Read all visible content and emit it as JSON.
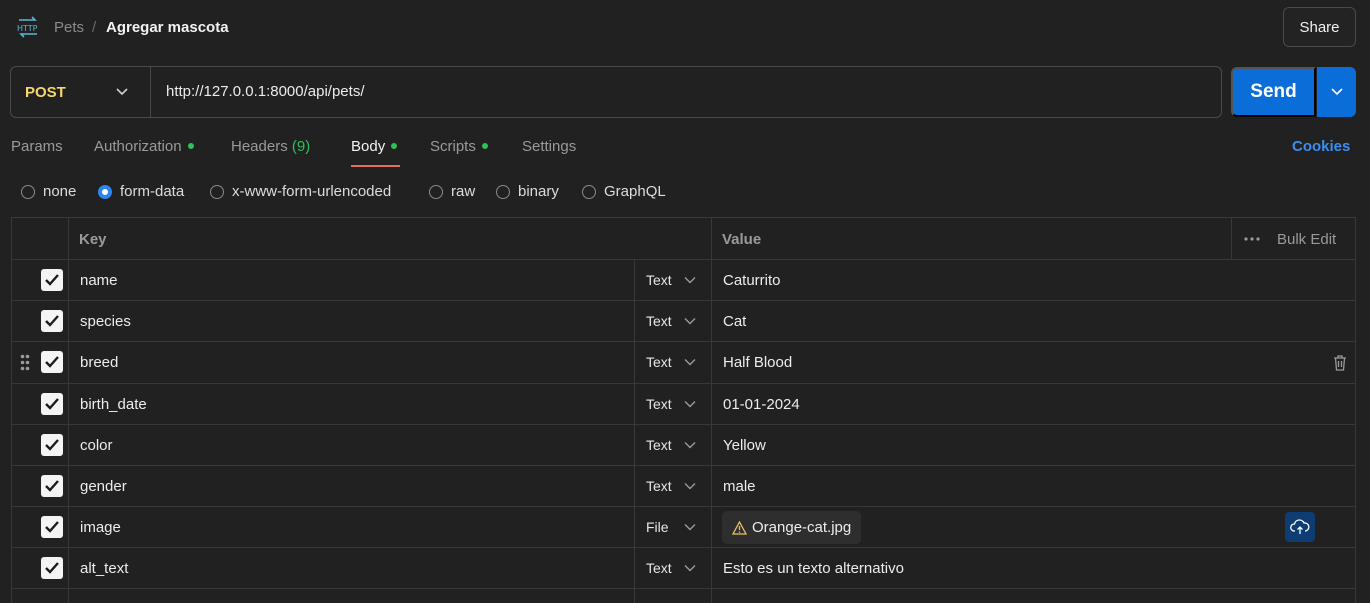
{
  "header": {
    "icon": "http-icon",
    "breadcrumb_parent": "Pets",
    "breadcrumb_sep": "/",
    "title": "Agregar mascota",
    "share_label": "Share"
  },
  "request": {
    "method": "POST",
    "method_color": "#f5d76e",
    "url": "http://127.0.0.1:8000/api/pets/",
    "send_label": "Send",
    "send_color": "#0b6ed8"
  },
  "tabs": [
    {
      "label": "Params"
    },
    {
      "label": "Authorization"
    },
    {
      "label": "Headers",
      "count": "(9)"
    },
    {
      "label": "Body",
      "active": true
    },
    {
      "label": "Scripts"
    },
    {
      "label": "Settings"
    }
  ],
  "cookies_label": "Cookies",
  "body_types": [
    "none",
    "form-data",
    "x-www-form-urlencoded",
    "raw",
    "binary",
    "GraphQL"
  ],
  "body_type_selected": "form-data",
  "table": {
    "key_header": "Key",
    "value_header": "Value",
    "bulk_edit": "Bulk Edit",
    "rows": [
      {
        "key": "name",
        "type": "Text",
        "value": "Caturrito",
        "checked": true
      },
      {
        "key": "species",
        "type": "Text",
        "value": "Cat",
        "checked": true
      },
      {
        "key": "breed",
        "type": "Text",
        "value": "Half Blood",
        "checked": true
      },
      {
        "key": "birth_date",
        "type": "Text",
        "value": "01-01-2024",
        "checked": true
      },
      {
        "key": "color",
        "type": "Text",
        "value": "Yellow",
        "checked": true
      },
      {
        "key": "gender",
        "type": "Text",
        "value": "male",
        "checked": true
      },
      {
        "key": "image",
        "type": "File",
        "value": "Orange-cat.jpg",
        "checked": true
      },
      {
        "key": "alt_text",
        "type": "Text",
        "value": "Esto es un texto alternativo",
        "checked": true
      }
    ]
  }
}
